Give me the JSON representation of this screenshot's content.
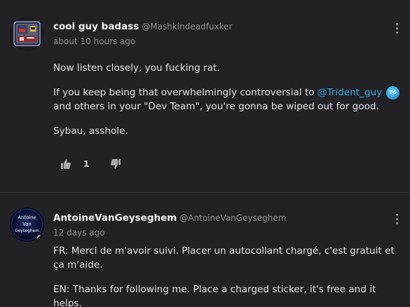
{
  "comments": [
    {
      "author_name": "cool guy badass",
      "author_handle": "@Mashkindeadfuxker",
      "timestamp": "about 10 hours ago",
      "paragraph_1": "Now listen closely, you fucking rat.",
      "paragraph_2_before": "If you keep being that overwhelmingly controversial to ",
      "mention": "@Trident_guy",
      "mention_badge_text": "TG",
      "paragraph_2_after": "and others in your \"Dev Team\", you're gonna be wiped out for good.",
      "paragraph_3": "Sybau, asshole.",
      "like_count": "1",
      "like_icon": "thumbs-up-icon",
      "dislike_icon": "thumbs-down-icon",
      "menu_icon": "more-vertical-icon"
    },
    {
      "author_name": "AntoineVanGeyseghem",
      "author_handle": "@AntoineVanGeyseghem",
      "timestamp": "12 days ago",
      "avatar_text": "Antoine Van Geyseghem",
      "paragraph_1": "FR: Merci de m'avoir suivi. Placer un autocollant chargé, c'est gratuit et ça m'aide.",
      "paragraph_2": "EN: Thanks for following me. Place a charged sticker, it's free and it helps.",
      "menu_icon": "more-vertical-icon"
    }
  ],
  "colors": {
    "background": "#222226",
    "mention": "#3aa8e8",
    "muted_text": "#8d8d94",
    "divider": "#3a3a40"
  }
}
